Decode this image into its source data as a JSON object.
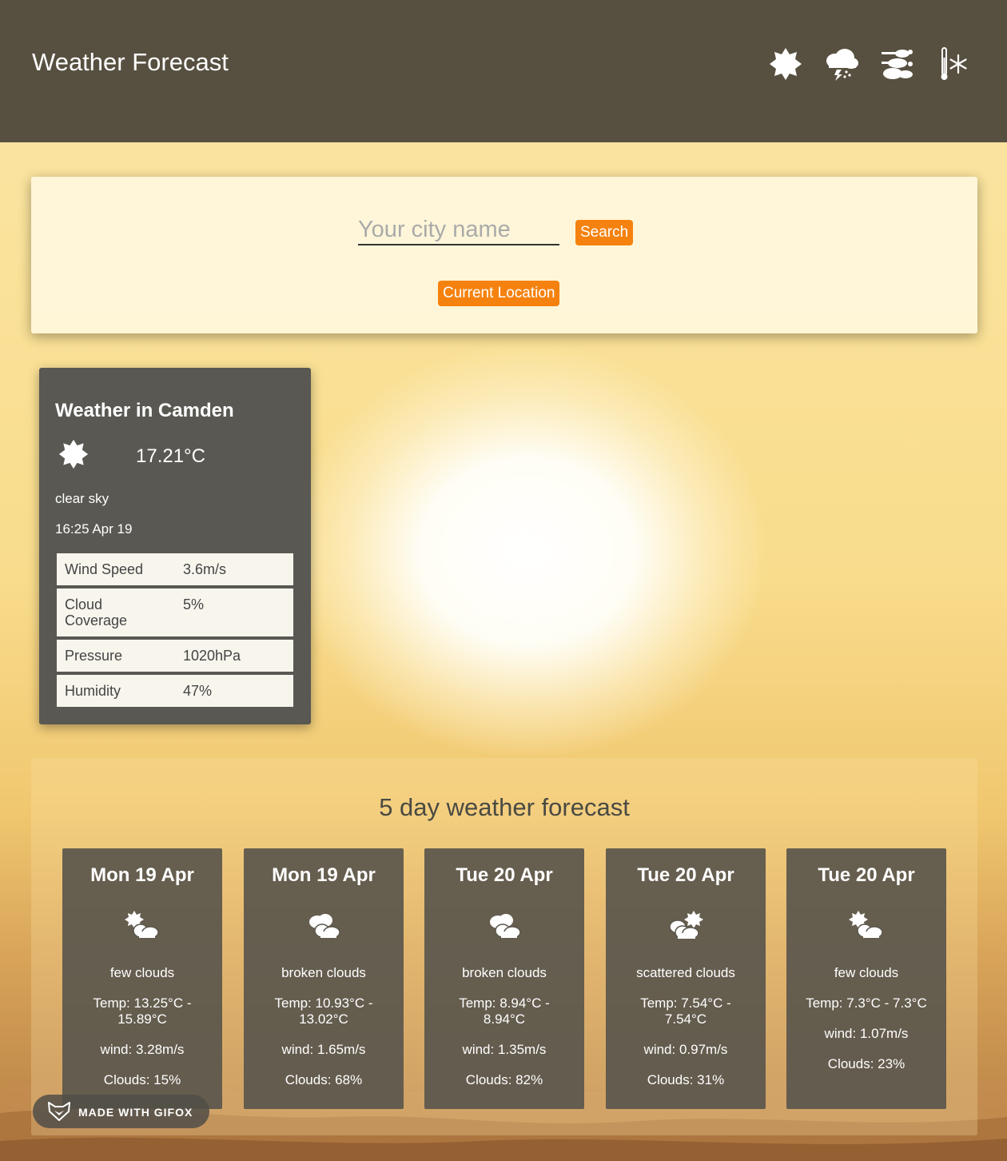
{
  "header": {
    "title": "Weather Forecast",
    "icons": [
      "sun-icon",
      "thunderstorm-icon",
      "wind-icon",
      "cold-thermometer-icon"
    ]
  },
  "search": {
    "placeholder": "Your city name",
    "search_label": "Search",
    "location_label": "Current Location"
  },
  "current": {
    "title": "Weather in Camden",
    "temperature": "17.21°C",
    "description": "clear sky",
    "time": "16:25 Apr 19",
    "stats": [
      {
        "label": "Wind Speed",
        "value": "3.6m/s"
      },
      {
        "label": "Cloud Coverage",
        "value": "5%"
      },
      {
        "label": "Pressure",
        "value": "1020hPa"
      },
      {
        "label": "Humidity",
        "value": "47%"
      }
    ]
  },
  "forecast": {
    "title": "5 day weather forecast",
    "days": [
      {
        "date": "Mon 19 Apr",
        "icon": "few-clouds-icon",
        "description": "few clouds",
        "temp": "Temp: 13.25°C - 15.89°C",
        "wind": "wind: 3.28m/s",
        "clouds": "Clouds: 15%"
      },
      {
        "date": "Mon 19 Apr",
        "icon": "broken-clouds-icon",
        "description": "broken clouds",
        "temp": "Temp: 10.93°C - 13.02°C",
        "wind": "wind: 1.65m/s",
        "clouds": "Clouds: 68%"
      },
      {
        "date": "Tue 20 Apr",
        "icon": "broken-clouds-icon",
        "description": "broken clouds",
        "temp": "Temp: 8.94°C - 8.94°C",
        "wind": "wind: 1.35m/s",
        "clouds": "Clouds: 82%"
      },
      {
        "date": "Tue 20 Apr",
        "icon": "scattered-clouds-icon",
        "description": "scattered clouds",
        "temp": "Temp: 7.54°C - 7.54°C",
        "wind": "wind: 0.97m/s",
        "clouds": "Clouds: 31%"
      },
      {
        "date": "Tue 20 Apr",
        "icon": "few-clouds-icon",
        "description": "few clouds",
        "temp": "Temp: 7.3°C - 7.3°C",
        "wind": "wind: 1.07m/s",
        "clouds": "Clouds: 23%"
      }
    ]
  },
  "watermark": {
    "text": "MADE WITH GIFOX"
  },
  "colors": {
    "header": "#575040",
    "accent": "#f5820f",
    "card": "#595852"
  }
}
